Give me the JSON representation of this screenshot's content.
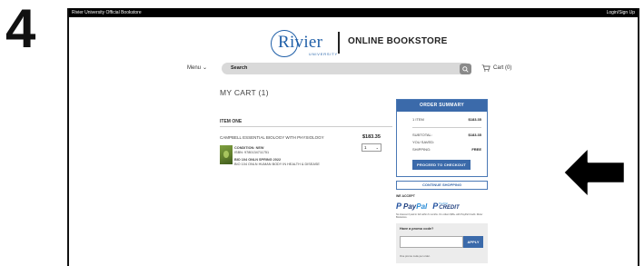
{
  "step": "4",
  "topbar": {
    "left": "Rivier University Official Bookstore",
    "right": "Login/Sign Up"
  },
  "brand": {
    "logo_text": "Rivier",
    "logo_sub": "UNIVERSITY",
    "title": "ONLINE BOOKSTORE"
  },
  "nav": {
    "menu_label": "Menu",
    "search_placeholder": "Search",
    "cart_label": "Cart (0)"
  },
  "cart": {
    "heading": "MY CART (1)",
    "section_title": "ITEM ONE",
    "item": {
      "name": "CAMPBELL ESSENTIAL BIOLOGY WITH PHYSIOLOGY",
      "price": "$183.35",
      "qty": "1",
      "condition": "CONDITION: NEW",
      "isbn": "ISBN: 9780134711751",
      "course": "BIO 104 ONLN SPRING 2022",
      "course_desc": "BIO 104 ONLN HUMAN BODY IN HEALTH & DISEASE"
    }
  },
  "summary": {
    "title": "ORDER SUMMARY",
    "item_label": "1 ITEM",
    "item_value": "$183.35",
    "subtotal_label": "SUBTOTAL:",
    "subtotal_value": "$183.35",
    "saved_label": "YOU SAVED:",
    "shipping_label": "SHIPPING:",
    "shipping_value": "FREE",
    "checkout_label": "PROCEED TO CHECKOUT"
  },
  "continue_label": "CONTINUE SHOPPING",
  "we_accept": "WE ACCEPT",
  "payments": {
    "paypal_a": "Pay",
    "paypal_b": "Pal",
    "credit_small": "PayPal",
    "credit_big": "CREDIT"
  },
  "fine_print": "No Interest if paid in full within 6 months. On orders $99+ with PayPal Credit. Rivier Bookstore.",
  "promo": {
    "label": "Have a promo code?",
    "apply": "APPLY",
    "note": "One promo code per order."
  },
  "colors": {
    "accent": "#3b6aaa",
    "logo": "#1f5fa8"
  }
}
